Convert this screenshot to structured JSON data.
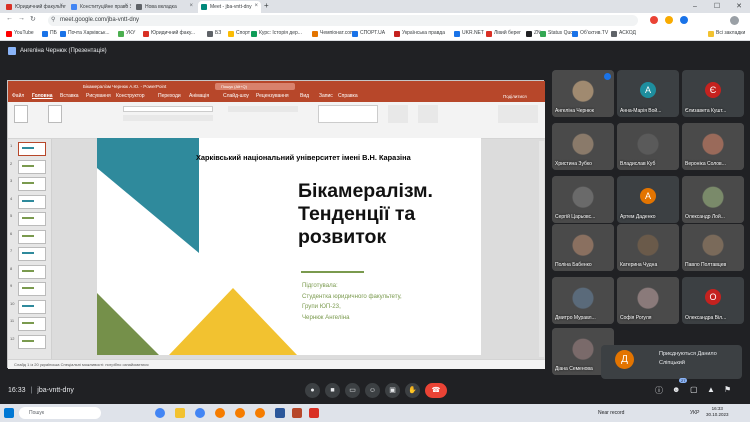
{
  "browser": {
    "tabs": [
      {
        "label": "Юридичний факультет",
        "color": "#d93025",
        "active": false
      },
      {
        "label": "Конституційне право України",
        "color": "#4285f4",
        "active": false
      },
      {
        "label": "Нова вкладка",
        "color": "#5f6368",
        "active": false
      },
      {
        "label": "Meet - jba-vntt-dny",
        "color": "#00897b",
        "active": true
      }
    ],
    "url": "meet.google.com/jba-vntt-dny",
    "bookmarks": [
      "YouTube",
      "ПБ",
      "Почта Харківськ...",
      "УКУ",
      "Юридичний факу...",
      "БЗ",
      "Спорт",
      "Курс: Історія дер...",
      "Чемпіонат.com",
      "СПОРТ.UA",
      "Українська правда",
      "UKR.NET",
      "Лівий берег",
      "ZN",
      "Status Quo",
      "Обʼєктив.TV",
      "АСКОД",
      "Всі закладки"
    ]
  },
  "meet": {
    "presenter_banner": "Ангеліна Чернюк (Презентація)",
    "time": "16:33",
    "separator": "|",
    "meeting_code": "jba-vntt-dny",
    "participant_count": "27",
    "participants": [
      {
        "name": "Ангеліна Чернюк",
        "type": "photo",
        "color": "#a08a70"
      },
      {
        "name": "Анна-Марія Вой...",
        "type": "avatar",
        "letter": "А",
        "color": "#1e8e9e"
      },
      {
        "name": "Єлизавета Кушт...",
        "type": "avatar",
        "letter": "Є",
        "color": "#c5221f"
      },
      {
        "name": "Христина Зубко",
        "type": "photo",
        "color": "#8a7a6a"
      },
      {
        "name": "Владислав Куб",
        "type": "photo",
        "color": "#5a5a5a"
      },
      {
        "name": "Вероніка Солов...",
        "type": "photo",
        "color": "#9a6a5a"
      },
      {
        "name": "Сергій Царьовс...",
        "type": "photo",
        "color": "#6a6a6a"
      },
      {
        "name": "Артем Даденко",
        "type": "avatar",
        "letter": "А",
        "color": "#e37400"
      },
      {
        "name": "Олександр Лой...",
        "type": "photo",
        "color": "#7a8a6a"
      },
      {
        "name": "Поліна Бабенко",
        "type": "photo",
        "color": "#8a7060"
      },
      {
        "name": "Катерина Чудна",
        "type": "photo",
        "color": "#6a5a4a"
      },
      {
        "name": "Павло Полтавцев",
        "type": "photo",
        "color": "#7a6a5a"
      },
      {
        "name": "Дмитро Муравл...",
        "type": "photo",
        "color": "#5a6a7a"
      },
      {
        "name": "Софія Рогуля",
        "type": "photo",
        "color": "#8a7a7a"
      },
      {
        "name": "Олександра Віл...",
        "type": "avatar",
        "letter": "О",
        "color": "#c5221f"
      },
      {
        "name": "Діана Семенова",
        "type": "photo",
        "color": "#7a6a6a"
      }
    ],
    "more": {
      "letter": "Д",
      "line1": "Приєднуються Данило",
      "line2": "Сліпцький"
    }
  },
  "ppt": {
    "title": "Бікамералізм Чернюк А.Ю. - PowerPoint",
    "search": "Пошук (Alt+Q)",
    "share": "Поділитися",
    "menu": [
      "Файл",
      "Головна",
      "Вставка",
      "Рисування",
      "Конструктор",
      "Переходи",
      "Анімація",
      "Слайд-шоу",
      "Рецензування",
      "Вид",
      "Запис",
      "Справка"
    ],
    "status": "Слайд 1 із 20    українська    Спеціальні можливості: потрібно ознайомитися"
  },
  "slide": {
    "university": "Харківський національний університет імені В.Н. Каразіна",
    "title_lines": [
      "Бікамералізм.",
      "Тенденції та",
      "розвиток"
    ],
    "info_lines": [
      "Підготувала:",
      "Студентка юридичного факультету,",
      "Групи ЮП-23,",
      "Чернюк Ангеліна"
    ]
  },
  "taskbar": {
    "search": "Пошук",
    "tray": "Near record",
    "lang": "УКР",
    "clock_time": "16:33",
    "clock_date": "30.10.2023"
  }
}
